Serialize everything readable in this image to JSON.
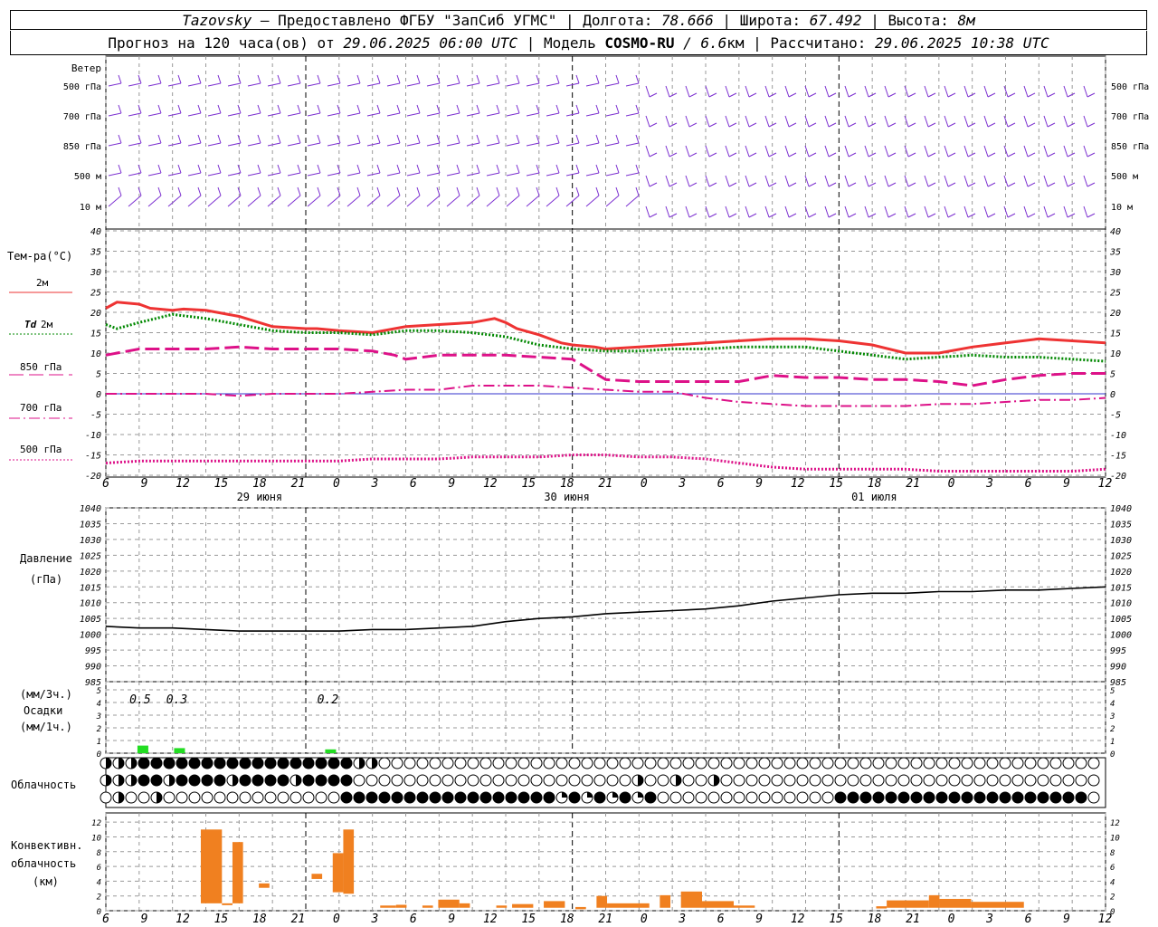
{
  "header": {
    "line1": {
      "station": "Tazovsky",
      "provider": " – Предоставлено ФГБУ \"ЗапСиб УГМС\" | Долгота: ",
      "lon": "78.666",
      "lat_label": " | Широта: ",
      "lat": "67.492",
      "alt_label": " | Высота: ",
      "alt": "8м"
    },
    "line2": {
      "prefix": "Прогноз на 120 часа(ов) от ",
      "issued": "29.06.2025 06:00 UTC",
      "model_label": "  | Модель ",
      "model": "COSMO-RU",
      "res": " / 6.6",
      "res_unit": "км",
      "calc_label": " | Рассчитано: ",
      "calc": "29.06.2025 10:38 UTC"
    }
  },
  "colors": {
    "wind": "#7b2fd0",
    "t2m": "#ee3333",
    "td2m": "#008800",
    "magenta": "#dd1188",
    "pressure": "#000000",
    "precip": "#22dd22",
    "conv": "#f08020",
    "grid": "#999999",
    "zero_line": "#3333cc"
  },
  "wind_panel": {
    "title": "Ветер",
    "levels": [
      "500 гПа",
      "700 гПа",
      "850 гПа",
      "500 м",
      "10  м"
    ]
  },
  "temp_panel": {
    "title": "Тем-ра(°C)",
    "legend": [
      {
        "label": "2м",
        "style": "solid",
        "color": "#ee3333"
      },
      {
        "label_prefix": "Td",
        "label": " 2м",
        "style": "dotted",
        "color": "#008800"
      },
      {
        "label": "850 гПа",
        "style": "longdash",
        "color": "#dd1188"
      },
      {
        "label": "700 гПа",
        "style": "dashdot",
        "color": "#dd1188"
      },
      {
        "label": "500 гПа",
        "style": "dotted",
        "color": "#dd1188"
      }
    ],
    "y_ticks": [
      "40",
      "35",
      "30",
      "25",
      "20",
      "15",
      "10",
      "5",
      "0",
      "-5",
      "-10",
      "-15",
      "-20"
    ]
  },
  "pressure_panel": {
    "title1": "Давление",
    "title2": "(гПа)",
    "y_ticks": [
      "1040",
      "1035",
      "1030",
      "1025",
      "1020",
      "1015",
      "1010",
      "1005",
      "1000",
      "995",
      "990",
      "985"
    ]
  },
  "precip_panel": {
    "title1": "(мм/3ч.)",
    "title2": "Осадки",
    "title3": "(мм/1ч.)",
    "y_ticks": [
      "5",
      "4",
      "3",
      "2",
      "1",
      "0"
    ],
    "labels": [
      {
        "x_hour": 9,
        "text": "0.5"
      },
      {
        "x_hour": 12,
        "text": "0.3"
      },
      {
        "x_hour": 24,
        "text": "0.2"
      }
    ]
  },
  "cloud_panel": {
    "title": "Облачность"
  },
  "conv_panel": {
    "title1": "Конвективн.",
    "title2": "облачность",
    "title3": "(км)",
    "y_ticks": [
      "12",
      "10",
      "8",
      "6",
      "4",
      "2",
      "0"
    ]
  },
  "x_axis": {
    "hour_labels": [
      "6",
      "9",
      "12",
      "15",
      "18",
      "21",
      "0",
      "3",
      "6",
      "9",
      "12",
      "15",
      "18",
      "21",
      "0",
      "3",
      "6",
      "9",
      "12",
      "15",
      "18",
      "21",
      "0",
      "3",
      "6",
      "9",
      "12"
    ],
    "date_labels": [
      {
        "text": "29 июня",
        "x_hour": 12
      },
      {
        "text": "30 июня",
        "x_hour": 36
      },
      {
        "text": "01 июля",
        "x_hour": 60
      }
    ]
  },
  "chart_data": [
    {
      "type": "line",
      "title": "Тем-ра(°C)",
      "x_unit": "hours from 29.06.2025 06 UTC",
      "ylim": [
        -20,
        40
      ],
      "series": [
        {
          "name": "2м",
          "x": [
            0,
            1,
            3,
            4,
            6,
            7,
            9,
            12,
            15,
            18,
            19,
            21,
            24,
            27,
            30,
            33,
            35,
            36,
            37,
            39,
            41,
            42,
            44,
            45,
            48,
            51,
            54,
            57,
            60,
            63,
            66,
            69,
            72,
            75,
            78,
            81,
            84,
            87,
            90
          ],
          "values": [
            21,
            22.5,
            22,
            21,
            20.5,
            20.8,
            20.5,
            19,
            16.5,
            16,
            16,
            15.5,
            15,
            16.5,
            17,
            17.5,
            18.5,
            17.5,
            16,
            14.5,
            12.5,
            12,
            11.5,
            11,
            11.5,
            12,
            12.5,
            13,
            13.5,
            13.5,
            13,
            12,
            10,
            10,
            11.5,
            12.5,
            13.5,
            13,
            12.5
          ]
        },
        {
          "name": "Td 2м",
          "x": [
            0,
            1,
            3,
            6,
            9,
            12,
            15,
            18,
            21,
            24,
            27,
            30,
            33,
            36,
            39,
            42,
            45,
            48,
            51,
            54,
            57,
            60,
            63,
            66,
            69,
            72,
            75,
            78,
            81,
            84,
            87,
            90
          ],
          "values": [
            17,
            16,
            17.5,
            19.5,
            18.5,
            17,
            15.5,
            15,
            15,
            14.5,
            15.5,
            15.5,
            15,
            14,
            12,
            11,
            10.5,
            10.5,
            11,
            11,
            11.5,
            11.5,
            11.5,
            10.5,
            9.5,
            8.5,
            9,
            9.5,
            9,
            9,
            8.5,
            8
          ]
        },
        {
          "name": "850 гПа",
          "x": [
            0,
            3,
            9,
            12,
            15,
            18,
            21,
            24,
            26,
            27,
            30,
            33,
            36,
            39,
            42,
            45,
            48,
            51,
            54,
            57,
            60,
            63,
            66,
            69,
            72,
            75,
            78,
            81,
            84,
            87,
            90
          ],
          "values": [
            9.5,
            11,
            11,
            11.5,
            11,
            11,
            11,
            10.5,
            9.5,
            8.5,
            9.5,
            9.5,
            9.5,
            9,
            8.5,
            3.5,
            3,
            3,
            3,
            3,
            4.5,
            4,
            4,
            3.5,
            3.5,
            3,
            2,
            3.5,
            4.5,
            5,
            5
          ]
        },
        {
          "name": "700 гПа",
          "x": [
            0,
            3,
            9,
            12,
            15,
            18,
            21,
            24,
            27,
            30,
            33,
            36,
            39,
            42,
            45,
            48,
            51,
            54,
            57,
            60,
            63,
            66,
            69,
            72,
            75,
            78,
            81,
            84,
            87,
            90
          ],
          "values": [
            0,
            0,
            0,
            -0.5,
            0,
            0,
            0,
            0.5,
            1,
            1,
            2,
            2,
            2,
            1.5,
            1,
            0.5,
            0.5,
            -1,
            -2,
            -2.5,
            -3,
            -3,
            -3,
            -3,
            -2.5,
            -2.5,
            -2,
            -1.5,
            -1.5,
            -1
          ]
        },
        {
          "name": "500 гПа",
          "x": [
            0,
            3,
            6,
            9,
            12,
            15,
            18,
            21,
            24,
            27,
            30,
            33,
            36,
            39,
            42,
            45,
            48,
            51,
            54,
            57,
            60,
            63,
            66,
            69,
            72,
            75,
            78,
            81,
            84,
            87,
            90
          ],
          "values": [
            -17,
            -16.5,
            -16.5,
            -16.5,
            -16.5,
            -16.5,
            -16.5,
            -16.5,
            -16,
            -16,
            -16,
            -15.5,
            -15.5,
            -15.5,
            -15,
            -15,
            -15.5,
            -15.5,
            -16,
            -17,
            -18,
            -18.5,
            -18.5,
            -18.5,
            -18.5,
            -19,
            -19,
            -19,
            -19,
            -19,
            -18.5
          ]
        }
      ]
    },
    {
      "type": "line",
      "title": "Давление",
      "ylabel": "(гПа)",
      "ylim": [
        985,
        1040
      ],
      "series": [
        {
          "name": "Давление",
          "x": [
            0,
            3,
            6,
            9,
            12,
            15,
            18,
            21,
            24,
            27,
            30,
            33,
            36,
            39,
            42,
            45,
            48,
            51,
            54,
            57,
            60,
            63,
            66,
            69,
            72,
            75,
            78,
            81,
            84,
            87,
            90
          ],
          "values": [
            1002.5,
            1002,
            1002,
            1001.5,
            1001,
            1001,
            1001,
            1001,
            1001.5,
            1001.5,
            1002,
            1002.5,
            1004,
            1005,
            1005.5,
            1006.5,
            1007,
            1007.5,
            1008,
            1009,
            1010.5,
            1011.5,
            1012.5,
            1013,
            1013,
            1013.5,
            1013.5,
            1014,
            1014,
            1014.5,
            1015
          ]
        }
      ]
    },
    {
      "type": "bar",
      "title": "Осадки",
      "ylabel": "(мм/3ч.) (мм/1ч.)",
      "ylim": [
        0,
        5
      ],
      "x": [
        9,
        12,
        24
      ],
      "values": [
        0.6,
        0.4,
        0.3
      ]
    },
    {
      "type": "bar",
      "title": "Конвективн. облачность",
      "ylabel": "(км)",
      "ylim": [
        0,
        12
      ],
      "bars": [
        {
          "x0": 9,
          "x1": 11,
          "bottom": 1,
          "top": 11
        },
        {
          "x0": 11,
          "x1": 12,
          "bottom": 1,
          "top": 1
        },
        {
          "x0": 12,
          "x1": 13,
          "bottom": 1,
          "top": 9.3
        },
        {
          "x0": 14.5,
          "x1": 15.5,
          "bottom": 3.1,
          "top": 3.7
        },
        {
          "x0": 19.5,
          "x1": 20.5,
          "bottom": 4.3,
          "top": 5
        },
        {
          "x0": 21.5,
          "x1": 22.5,
          "bottom": 2.5,
          "top": 7.8
        },
        {
          "x0": 22.5,
          "x1": 23.5,
          "bottom": 2.3,
          "top": 11
        },
        {
          "x0": 26,
          "x1": 27.5,
          "bottom": 0.4,
          "top": 0.7
        },
        {
          "x0": 27.5,
          "x1": 28.5,
          "bottom": 0.4,
          "top": 0.8
        },
        {
          "x0": 30,
          "x1": 31,
          "bottom": 0.4,
          "top": 0.7
        },
        {
          "x0": 31.5,
          "x1": 33.5,
          "bottom": 0.4,
          "top": 1.5
        },
        {
          "x0": 33.5,
          "x1": 34.5,
          "bottom": 0.4,
          "top": 1
        },
        {
          "x0": 37,
          "x1": 38,
          "bottom": 0.4,
          "top": 0.7
        },
        {
          "x0": 38.5,
          "x1": 40.5,
          "bottom": 0.4,
          "top": 0.9
        },
        {
          "x0": 41.5,
          "x1": 43.5,
          "bottom": 0.4,
          "top": 1.3
        },
        {
          "x0": 44.5,
          "x1": 45.5,
          "bottom": 0.2,
          "top": 0.5
        },
        {
          "x0": 46.5,
          "x1": 47.5,
          "bottom": 0.4,
          "top": 2
        },
        {
          "x0": 47.5,
          "x1": 50.5,
          "bottom": 0.4,
          "top": 1
        },
        {
          "x0": 50.5,
          "x1": 51.5,
          "bottom": 0.4,
          "top": 1
        },
        {
          "x0": 52.5,
          "x1": 53.5,
          "bottom": 0.4,
          "top": 2.1
        },
        {
          "x0": 54.5,
          "x1": 56.5,
          "bottom": 0.4,
          "top": 2.6
        },
        {
          "x0": 56.5,
          "x1": 59.5,
          "bottom": 0.4,
          "top": 1.3
        },
        {
          "x0": 59.5,
          "x1": 61.5,
          "bottom": 0.4,
          "top": 0.7
        },
        {
          "x0": 73,
          "x1": 74,
          "bottom": 0.3,
          "top": 0.6
        },
        {
          "x0": 74,
          "x1": 78,
          "bottom": 0.4,
          "top": 1.4
        },
        {
          "x0": 78,
          "x1": 79,
          "bottom": 0.4,
          "top": 2.1
        },
        {
          "x0": 79,
          "x1": 82,
          "bottom": 0.4,
          "top": 1.6
        },
        {
          "x0": 82,
          "x1": 87,
          "bottom": 0.4,
          "top": 1.2
        }
      ]
    }
  ]
}
